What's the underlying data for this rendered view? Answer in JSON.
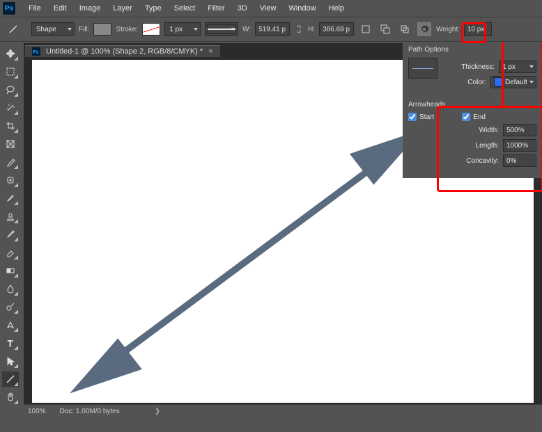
{
  "menubar": [
    "File",
    "Edit",
    "Image",
    "Layer",
    "Type",
    "Select",
    "Filter",
    "3D",
    "View",
    "Window",
    "Help"
  ],
  "logo": "Ps",
  "options": {
    "mode": "Shape",
    "fill_label": "Fill:",
    "stroke_label": "Stroke:",
    "stroke_size": "1 px",
    "w_label": "W:",
    "w_value": "519.41 p",
    "h_label": "H:",
    "h_value": "386.69 p",
    "weight_label": "Weight:",
    "weight_value": "10 px"
  },
  "document": {
    "tab": "Untitled-1 @ 100% (Shape 2, RGB/8/CMYK) *"
  },
  "flyout": {
    "path_options": "Path Options",
    "thickness_label": "Thickness:",
    "thickness_value": "1 px",
    "color_label": "Color:",
    "color_value": "Default",
    "arrowheads": "Arrowheads",
    "start_label": "Start",
    "start_checked": true,
    "end_label": "End",
    "end_checked": true,
    "width_label": "Width:",
    "width_value": "500%",
    "length_label": "Length:",
    "length_value": "1000%",
    "concavity_label": "Concavity:",
    "concavity_value": "0%"
  },
  "status": {
    "zoom": "100%",
    "doc": "Doc: 1.00M/0 bytes"
  }
}
